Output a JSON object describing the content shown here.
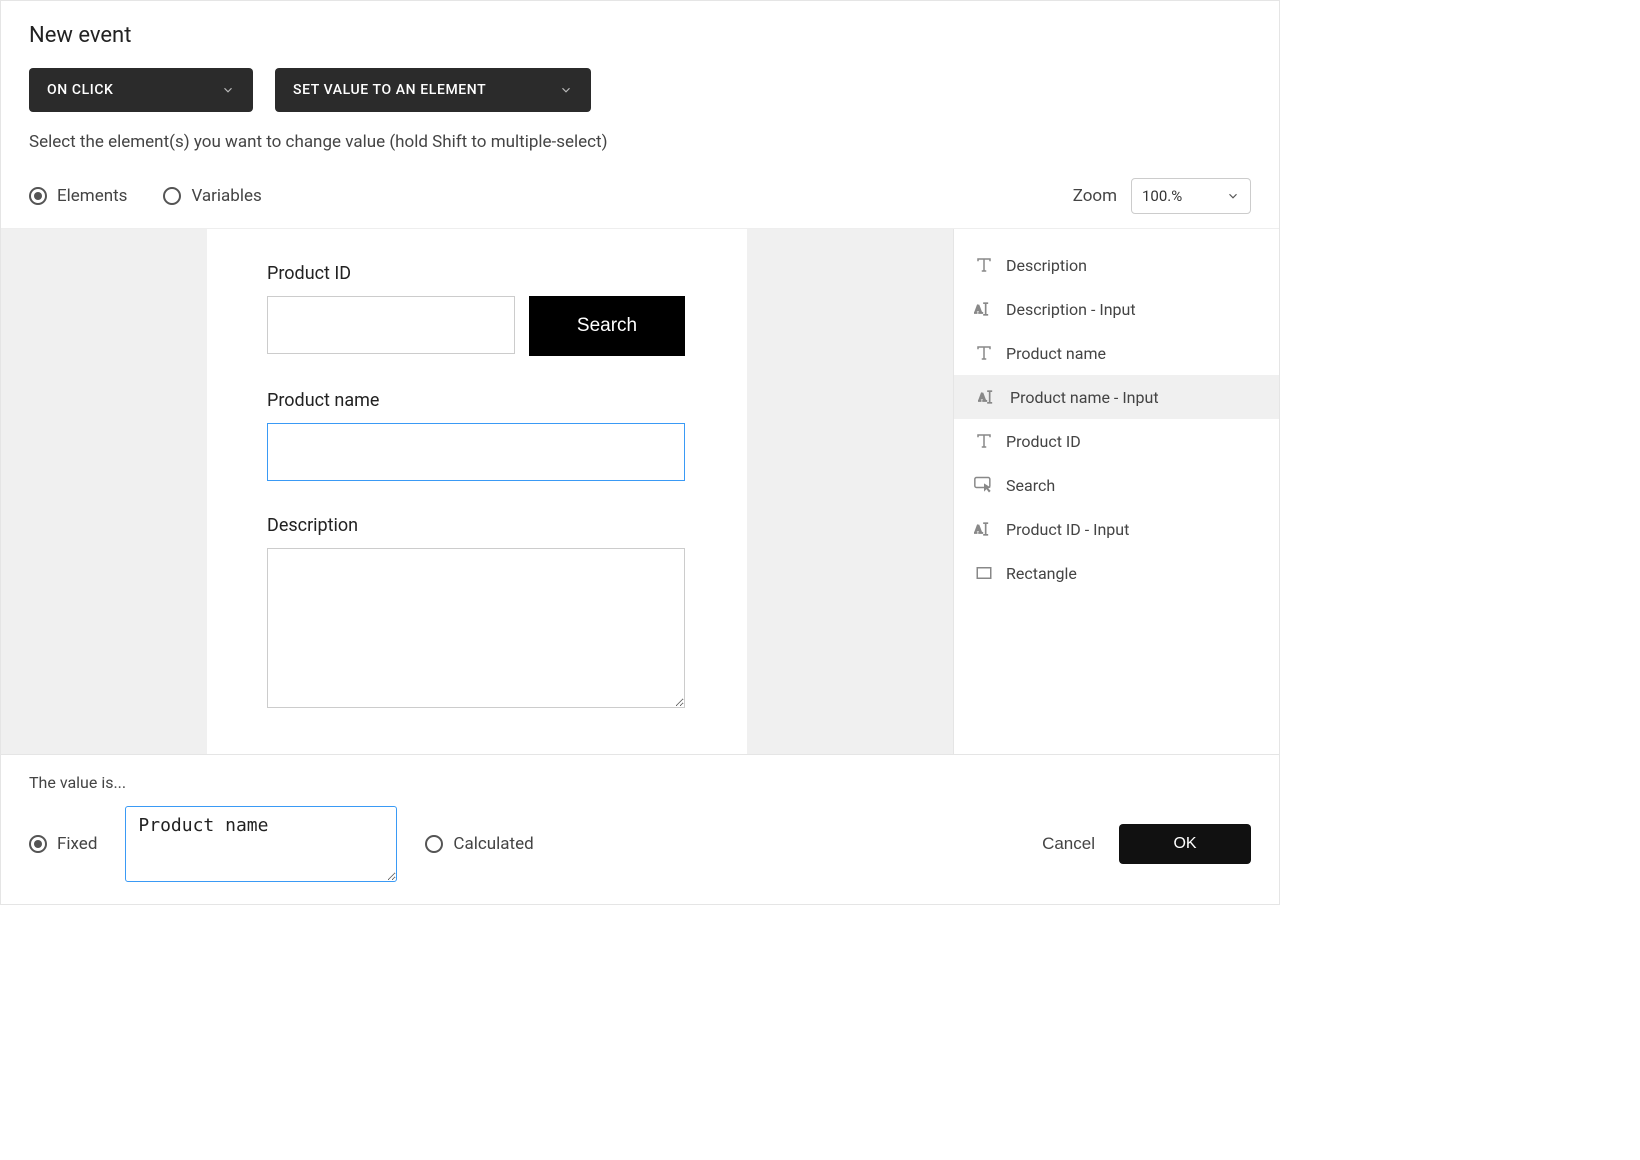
{
  "header": {
    "title": "New event",
    "trigger_label": "ON CLICK",
    "action_label": "SET VALUE TO AN ELEMENT",
    "instruction": "Select the element(s) you want to change value (hold Shift to multiple-select)",
    "radio_elements": "Elements",
    "radio_variables": "Variables",
    "zoom_label": "Zoom",
    "zoom_value": "100.%"
  },
  "canvas": {
    "product_id_label": "Product ID",
    "product_id_value": "",
    "search_label": "Search",
    "product_name_label": "Product name",
    "product_name_value": "",
    "description_label": "Description",
    "description_value": ""
  },
  "elements": [
    {
      "icon": "text",
      "label": "Description",
      "selected": false
    },
    {
      "icon": "input",
      "label": "Description - Input",
      "selected": false
    },
    {
      "icon": "text",
      "label": "Product name",
      "selected": false
    },
    {
      "icon": "input",
      "label": "Product name - Input",
      "selected": true
    },
    {
      "icon": "text",
      "label": "Product ID",
      "selected": false
    },
    {
      "icon": "button",
      "label": "Search",
      "selected": false
    },
    {
      "icon": "input",
      "label": "Product ID - Input",
      "selected": false
    },
    {
      "icon": "rect",
      "label": "Rectangle",
      "selected": false
    }
  ],
  "footer": {
    "label": "The value is...",
    "radio_fixed": "Fixed",
    "radio_calculated": "Calculated",
    "value_input": "Product name",
    "cancel": "Cancel",
    "ok": "OK"
  }
}
